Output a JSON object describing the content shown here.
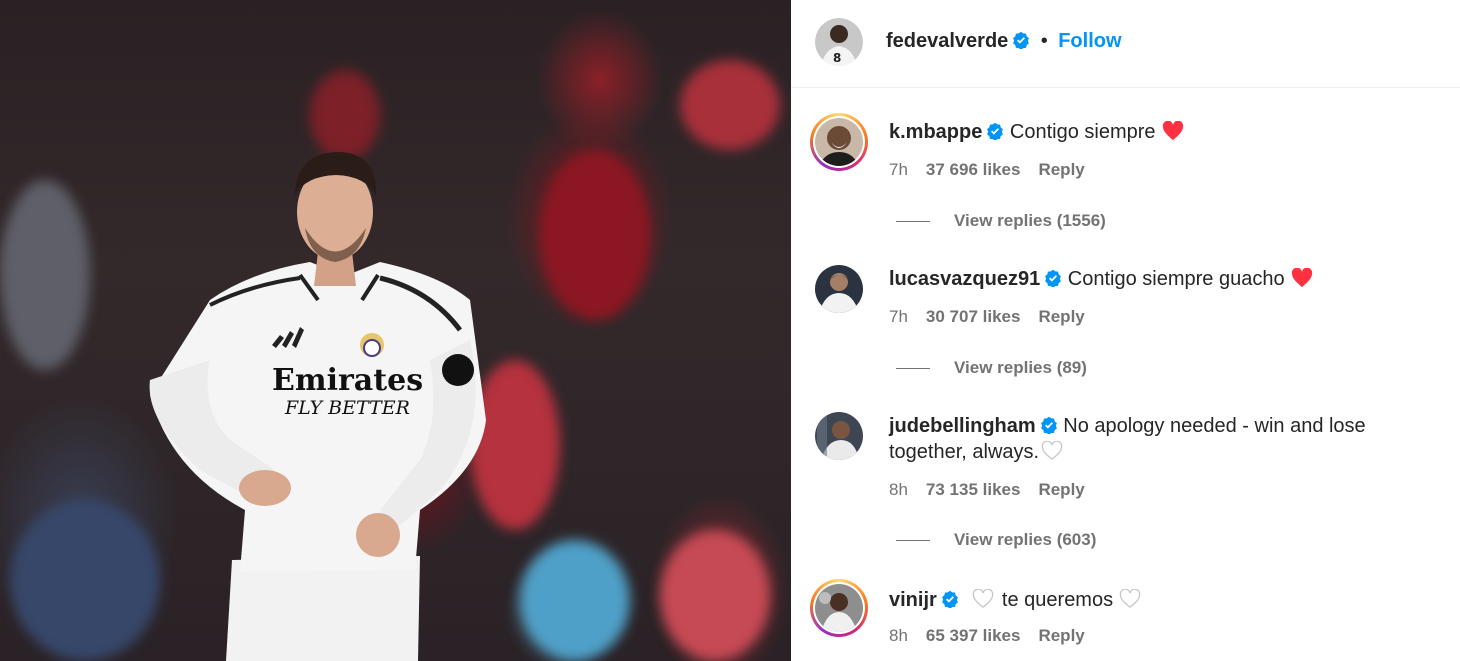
{
  "post": {
    "author": "fedevalverde",
    "follow_label": "Follow",
    "separator": "•",
    "photo_text": {
      "sponsor_line1": "Emirates",
      "sponsor_line2": "FLY BETTER"
    }
  },
  "comments": [
    {
      "username": "k.mbappe",
      "text": "Contigo siempre",
      "trailing_icon": "red-heart",
      "time": "7h",
      "likes": "37 696 likes",
      "reply_label": "Reply",
      "view_replies": "View replies (1556)",
      "has_story_ring": true
    },
    {
      "username": "lucasvazquez91",
      "text": "Contigo siempre guacho",
      "trailing_icon": "red-heart",
      "time": "7h",
      "likes": "30 707 likes",
      "reply_label": "Reply",
      "view_replies": "View replies (89)",
      "has_story_ring": false
    },
    {
      "username": "judebellingham",
      "text": "No apology needed - win and lose together, always.",
      "trailing_icon": "white-heart",
      "time": "8h",
      "likes": "73 135 likes",
      "reply_label": "Reply",
      "view_replies": "View replies (603)",
      "has_story_ring": false
    },
    {
      "username": "vinijr",
      "text": "te queremos",
      "leading_icon": "white-heart",
      "trailing_icon": "white-heart",
      "time": "8h",
      "likes": "65 397 likes",
      "reply_label": "Reply",
      "has_story_ring": true
    }
  ],
  "colors": {
    "follow": "#0095f6",
    "verified": "#0095f6",
    "heart_red": "#ff3040",
    "meta_gray": "#737373"
  }
}
